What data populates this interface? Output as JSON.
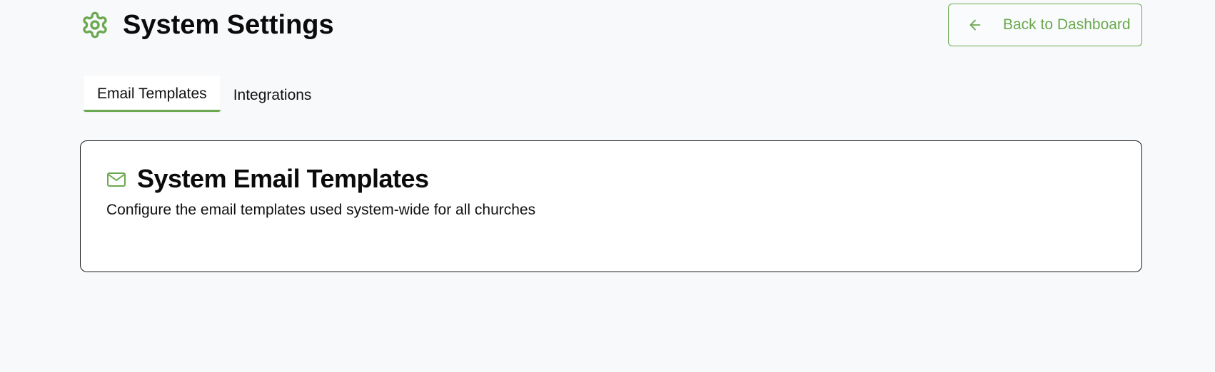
{
  "header": {
    "title": "System Settings",
    "icon": "gear-icon",
    "back_button_label": "Back to Dashboard",
    "back_button_icon": "arrow-left-icon"
  },
  "tabs": [
    {
      "label": "Email Templates",
      "active": true
    },
    {
      "label": "Integrations",
      "active": false
    }
  ],
  "card": {
    "icon": "mail-icon",
    "title": "System Email Templates",
    "description": "Configure the email templates used system-wide for all churches"
  },
  "colors": {
    "accent": "#6aa84f",
    "background": "#f8f9fb",
    "card_background": "#ffffff",
    "text": "#111111"
  }
}
